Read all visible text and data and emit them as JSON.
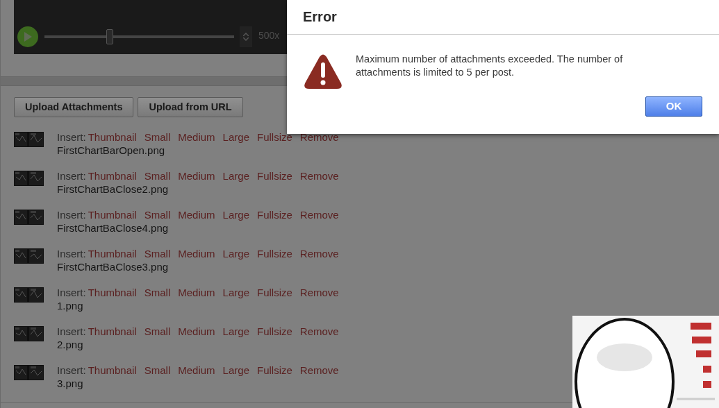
{
  "player": {
    "slider": {
      "level": 0.34
    },
    "speed": "500x"
  },
  "buttons": [
    "Upload Attachments",
    "Upload from URL"
  ],
  "attachments": [
    {
      "insert_label": "Insert:",
      "links": [
        "Thumbnail",
        "Small",
        "Medium",
        "Large",
        "Fullsize",
        "Remove"
      ],
      "filename": "FirstChartBarOpen.png"
    },
    {
      "insert_label": "Insert:",
      "links": [
        "Thumbnail",
        "Small",
        "Medium",
        "Large",
        "Fullsize",
        "Remove"
      ],
      "filename": "FirstChartBaClose2.png"
    },
    {
      "insert_label": "Insert:",
      "links": [
        "Thumbnail",
        "Small",
        "Medium",
        "Large",
        "Fullsize",
        "Remove"
      ],
      "filename": "FirstChartBaClose4.png"
    },
    {
      "insert_label": "Insert:",
      "links": [
        "Thumbnail",
        "Small",
        "Medium",
        "Large",
        "Fullsize",
        "Remove"
      ],
      "filename": "FirstChartBaClose3.png"
    },
    {
      "insert_label": "Insert:",
      "links": [
        "Thumbnail",
        "Small",
        "Medium",
        "Large",
        "Fullsize",
        "Remove"
      ],
      "filename": "1.png"
    },
    {
      "insert_label": "Insert:",
      "links": [
        "Thumbnail",
        "Small",
        "Medium",
        "Large",
        "Fullsize",
        "Remove"
      ],
      "filename": "2.png"
    },
    {
      "insert_label": "Insert:",
      "links": [
        "Thumbnail",
        "Small",
        "Medium",
        "Large",
        "Fullsize",
        "Remove"
      ],
      "filename": "3.png"
    }
  ],
  "dialog": {
    "title": "Error",
    "message": "Maximum number of attachments exceeded. The number of attachments is limited to 5 per post.",
    "button": "OK"
  }
}
